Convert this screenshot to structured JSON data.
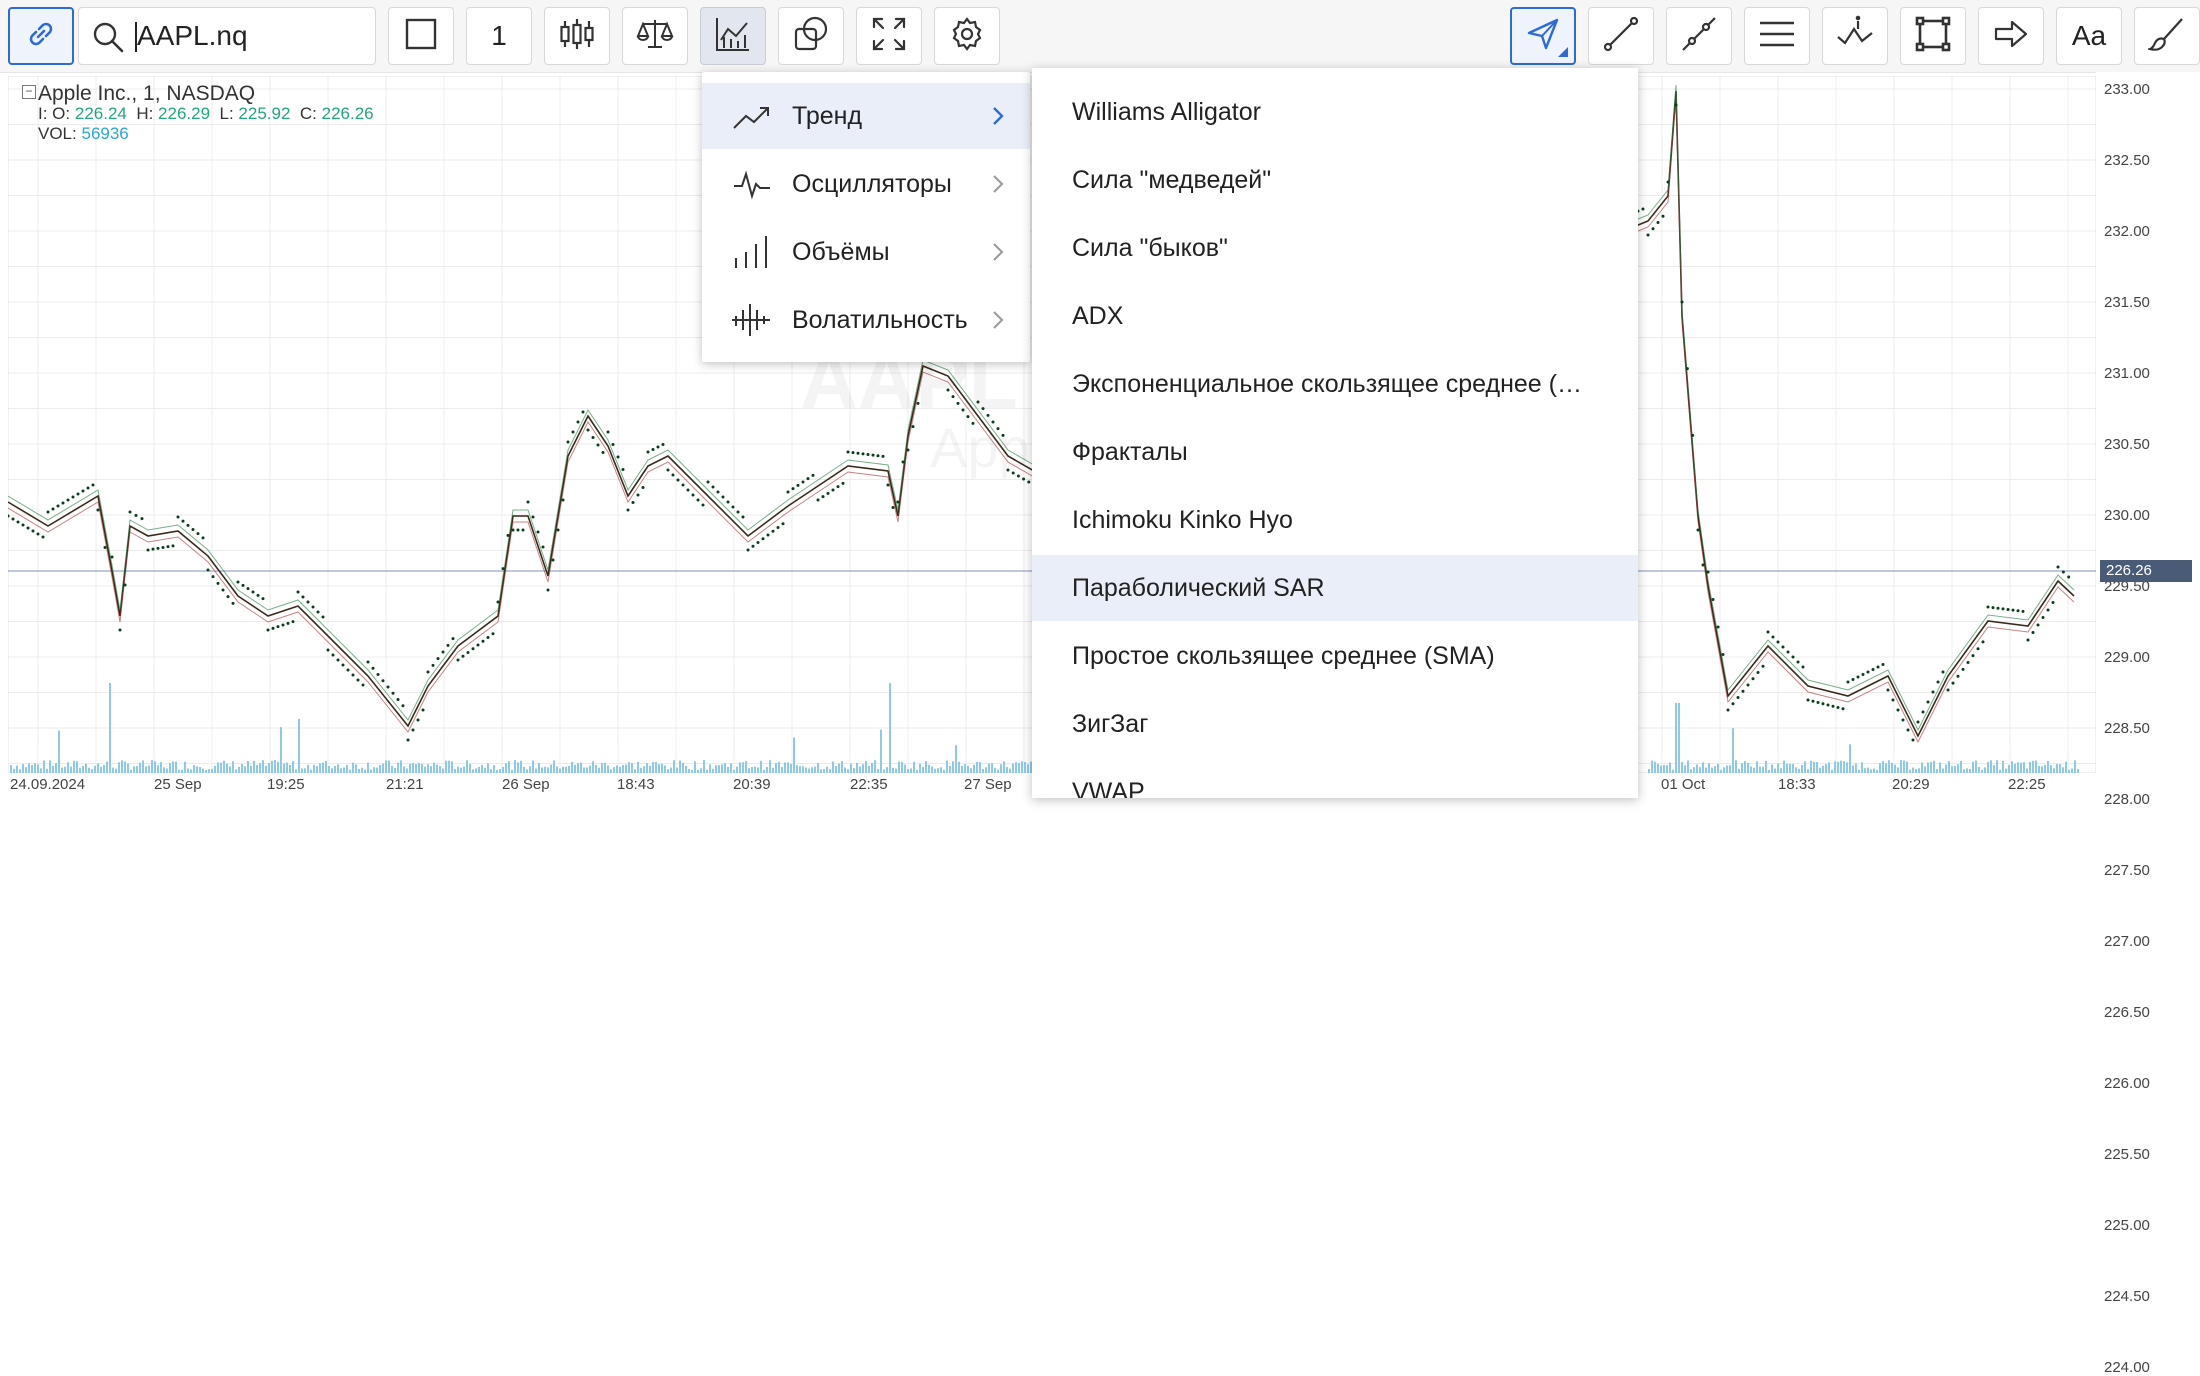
{
  "symbol_search": {
    "value": "AAPL.nq",
    "icon": "search-icon"
  },
  "toolbar": {
    "link_icon": "link-icon",
    "chart_shape_icon": "square-icon",
    "timeframe_label": "1",
    "candles_icon": "candlestick-icon",
    "compare_icon": "scales-icon",
    "indicators_icon": "indicators-icon",
    "objects_icon": "shapes-icon",
    "fullscreen_icon": "expand-icon",
    "settings_icon": "gear-icon",
    "cursor_icon": "cursor-arrow-icon",
    "line_icon": "trend-line-icon",
    "ray_icon": "ray-icon",
    "channel_icon": "parallel-lines-icon",
    "info_line_icon": "info-line-icon",
    "rectangle_icon": "rectangle-icon",
    "arrow_icon": "arrow-icon",
    "text_label": "Aa",
    "brush_icon": "brush-icon",
    "accent_color": "#2e6bd6"
  },
  "legend": {
    "title": "Apple Inc.,  1,  NASDAQ",
    "open_label": "I: O:",
    "open": "226.24",
    "high_label": "H:",
    "high": "226.29",
    "low_label": "L:",
    "low": "225.92",
    "close_label": "C:",
    "close": "226.26",
    "vol_label": "VOL:",
    "vol": "56936"
  },
  "watermark": {
    "symbol": "AAPL",
    "name": "Apple"
  },
  "price_axis": {
    "labels": [
      "233.00",
      "232.50",
      "232.00",
      "231.50",
      "231.00",
      "230.50",
      "230.00",
      "229.50",
      "229.00",
      "228.50",
      "228.00",
      "227.50",
      "227.00",
      "226.50",
      "226.00",
      "225.50",
      "225.00",
      "224.50",
      "224.00"
    ],
    "current_price": "226.26",
    "current_color": "#4a5b78"
  },
  "time_axis": {
    "labels": [
      "24.09.2024",
      "25 Sep",
      "19:25",
      "21:21",
      "26 Sep",
      "18:43",
      "20:39",
      "22:35",
      "27 Sep",
      "01 Oct",
      "18:33",
      "20:29",
      "22:25"
    ]
  },
  "indicator_categories": [
    {
      "label": "Тренд",
      "icon": "trend-icon",
      "selected": true
    },
    {
      "label": "Осцилляторы",
      "icon": "oscillator-icon",
      "selected": false
    },
    {
      "label": "Объёмы",
      "icon": "volume-bars-icon",
      "selected": false
    },
    {
      "label": "Волатильность",
      "icon": "volatility-icon",
      "selected": false
    }
  ],
  "trend_indicators": [
    {
      "label": "Williams Alligator",
      "selected": false
    },
    {
      "label": "Сила \"медведей\"",
      "selected": false
    },
    {
      "label": "Сила \"быков\"",
      "selected": false
    },
    {
      "label": "ADX",
      "selected": false
    },
    {
      "label": "Экспоненциальное скользящее среднее (…",
      "selected": false
    },
    {
      "label": "Фракталы",
      "selected": false
    },
    {
      "label": "Ichimoku Kinko Hyo",
      "selected": false
    },
    {
      "label": "Параболический SAR",
      "selected": true
    },
    {
      "label": "Простое скользящее среднее (SMA)",
      "selected": false
    },
    {
      "label": "ЗигЗаг",
      "selected": false
    },
    {
      "label": "VWAP",
      "selected": false
    }
  ]
}
